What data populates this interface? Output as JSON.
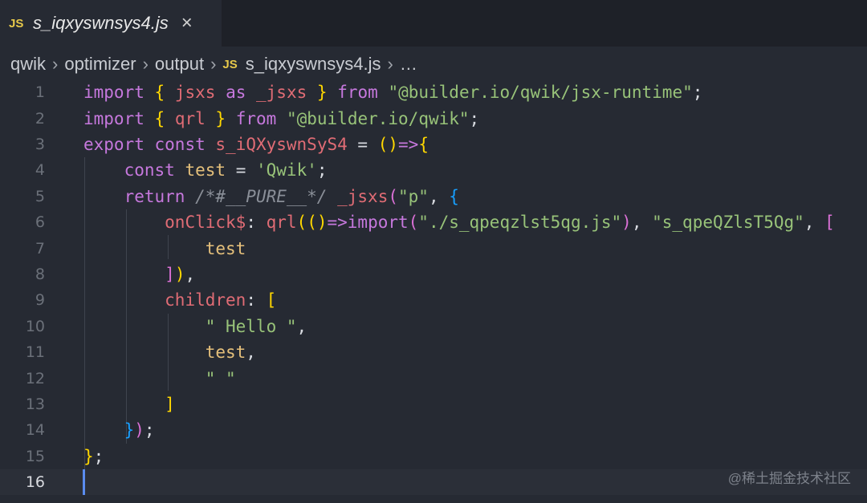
{
  "tab": {
    "badge": "JS",
    "label": "s_iqxyswnsys4.js",
    "close": "×"
  },
  "breadcrumb": {
    "items": [
      "qwik",
      "optimizer",
      "output"
    ],
    "file_badge": "JS",
    "file": "s_iqxyswnsys4.js",
    "more": "…",
    "separator": "›"
  },
  "editor": {
    "line_numbers": [
      "1",
      "2",
      "3",
      "4",
      "5",
      "6",
      "7",
      "8",
      "9",
      "10",
      "11",
      "12",
      "13",
      "14",
      "15",
      "16"
    ],
    "current_line": "16"
  },
  "watermark": "@稀土掘金技术社区",
  "colors": {
    "background": "#262a33",
    "tabbar": "#1e2128",
    "cursor": "#5a8cf0"
  }
}
